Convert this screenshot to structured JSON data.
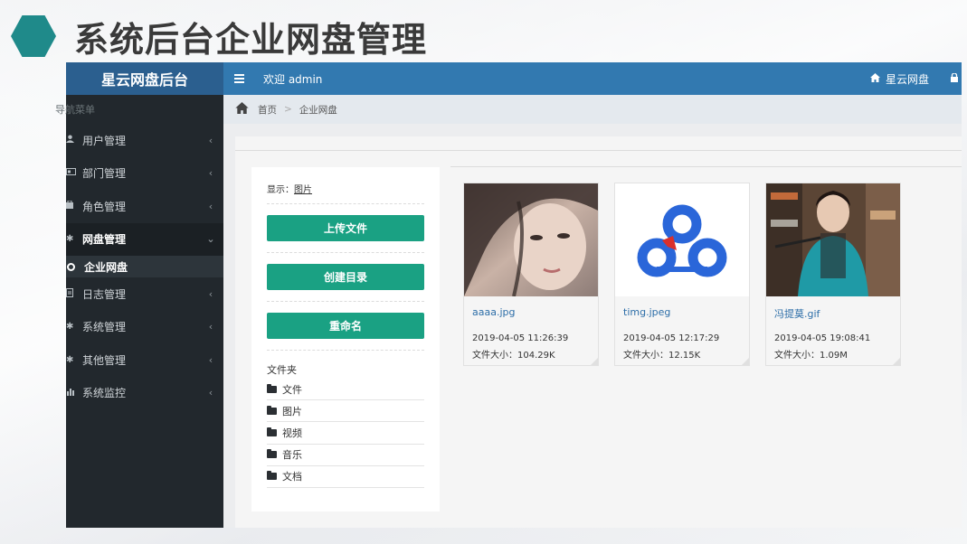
{
  "slide": {
    "title": "系统后台企业网盘管理"
  },
  "sidebar": {
    "brand": "星云网盘后台",
    "nav_header": "导航菜单",
    "items": [
      {
        "label": "用户管理",
        "icon": "user-icon",
        "chevron": "‹"
      },
      {
        "label": "部门管理",
        "icon": "id-card-icon",
        "chevron": "‹"
      },
      {
        "label": "角色管理",
        "icon": "role-icon",
        "chevron": "‹"
      },
      {
        "label": "网盘管理",
        "icon": "gear-icon",
        "chevron": "⌄"
      },
      {
        "label": "日志管理",
        "icon": "document-icon",
        "chevron": "‹"
      },
      {
        "label": "系统管理",
        "icon": "gear-icon",
        "chevron": "‹"
      },
      {
        "label": "其他管理",
        "icon": "gear-icon",
        "chevron": "‹"
      },
      {
        "label": "系统监控",
        "icon": "bar-chart-icon",
        "chevron": "‹"
      }
    ],
    "sub_item": {
      "label": "企业网盘"
    }
  },
  "topbar": {
    "welcome": "欢迎 admin",
    "home_link": "星云网盘"
  },
  "breadcrumb": {
    "home": "首页",
    "separator": ">",
    "current": "企业网盘"
  },
  "panel": {
    "show_prefix": "显示：",
    "show_value": "图片",
    "buttons": {
      "upload": "上传文件",
      "mkdir": "创建目录",
      "rename": "重命名"
    },
    "folder_title": "文件夹",
    "folders": [
      "文件",
      "图片",
      "视频",
      "音乐",
      "文档"
    ]
  },
  "files": [
    {
      "name": "aaaa.jpg",
      "date": "2019-04-05 11:26:39",
      "size": "文件大小：104.29K"
    },
    {
      "name": "timg.jpeg",
      "date": "2019-04-05 12:17:29",
      "size": "文件大小：12.15K"
    },
    {
      "name": "冯提莫.gif",
      "date": "2019-04-05 19:08:41",
      "size": "文件大小：1.09M"
    }
  ],
  "colors": {
    "accent_green": "#1aa183",
    "topbar_blue": "#3279b0",
    "sidebar_dark": "#22282d",
    "hexagon_teal": "#1f8a8a"
  }
}
